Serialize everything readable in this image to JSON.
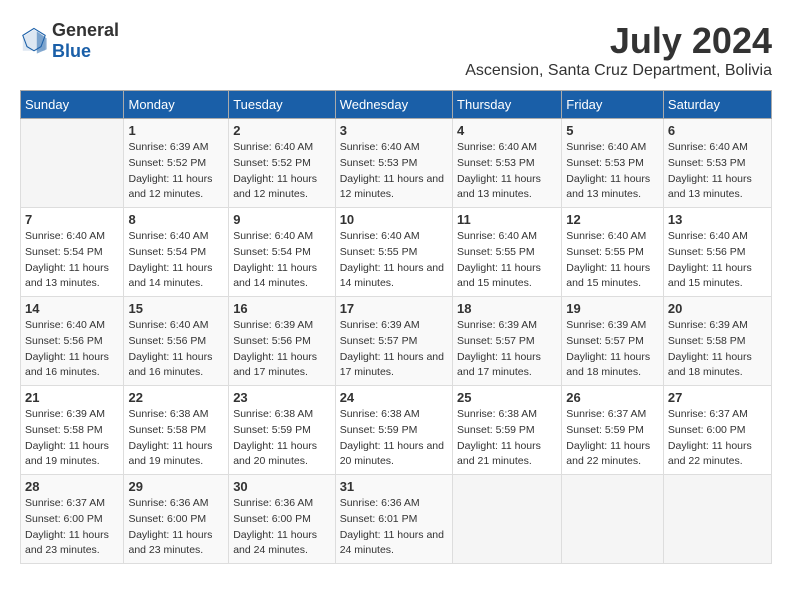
{
  "logo": {
    "text_general": "General",
    "text_blue": "Blue"
  },
  "title": {
    "month_year": "July 2024",
    "location": "Ascension, Santa Cruz Department, Bolivia"
  },
  "calendar": {
    "headers": [
      "Sunday",
      "Monday",
      "Tuesday",
      "Wednesday",
      "Thursday",
      "Friday",
      "Saturday"
    ],
    "weeks": [
      [
        {
          "day": "",
          "sunrise": "",
          "sunset": "",
          "daylight": ""
        },
        {
          "day": "1",
          "sunrise": "Sunrise: 6:39 AM",
          "sunset": "Sunset: 5:52 PM",
          "daylight": "Daylight: 11 hours and 12 minutes."
        },
        {
          "day": "2",
          "sunrise": "Sunrise: 6:40 AM",
          "sunset": "Sunset: 5:52 PM",
          "daylight": "Daylight: 11 hours and 12 minutes."
        },
        {
          "day": "3",
          "sunrise": "Sunrise: 6:40 AM",
          "sunset": "Sunset: 5:53 PM",
          "daylight": "Daylight: 11 hours and 12 minutes."
        },
        {
          "day": "4",
          "sunrise": "Sunrise: 6:40 AM",
          "sunset": "Sunset: 5:53 PM",
          "daylight": "Daylight: 11 hours and 13 minutes."
        },
        {
          "day": "5",
          "sunrise": "Sunrise: 6:40 AM",
          "sunset": "Sunset: 5:53 PM",
          "daylight": "Daylight: 11 hours and 13 minutes."
        },
        {
          "day": "6",
          "sunrise": "Sunrise: 6:40 AM",
          "sunset": "Sunset: 5:53 PM",
          "daylight": "Daylight: 11 hours and 13 minutes."
        }
      ],
      [
        {
          "day": "7",
          "sunrise": "Sunrise: 6:40 AM",
          "sunset": "Sunset: 5:54 PM",
          "daylight": "Daylight: 11 hours and 13 minutes."
        },
        {
          "day": "8",
          "sunrise": "Sunrise: 6:40 AM",
          "sunset": "Sunset: 5:54 PM",
          "daylight": "Daylight: 11 hours and 14 minutes."
        },
        {
          "day": "9",
          "sunrise": "Sunrise: 6:40 AM",
          "sunset": "Sunset: 5:54 PM",
          "daylight": "Daylight: 11 hours and 14 minutes."
        },
        {
          "day": "10",
          "sunrise": "Sunrise: 6:40 AM",
          "sunset": "Sunset: 5:55 PM",
          "daylight": "Daylight: 11 hours and 14 minutes."
        },
        {
          "day": "11",
          "sunrise": "Sunrise: 6:40 AM",
          "sunset": "Sunset: 5:55 PM",
          "daylight": "Daylight: 11 hours and 15 minutes."
        },
        {
          "day": "12",
          "sunrise": "Sunrise: 6:40 AM",
          "sunset": "Sunset: 5:55 PM",
          "daylight": "Daylight: 11 hours and 15 minutes."
        },
        {
          "day": "13",
          "sunrise": "Sunrise: 6:40 AM",
          "sunset": "Sunset: 5:56 PM",
          "daylight": "Daylight: 11 hours and 15 minutes."
        }
      ],
      [
        {
          "day": "14",
          "sunrise": "Sunrise: 6:40 AM",
          "sunset": "Sunset: 5:56 PM",
          "daylight": "Daylight: 11 hours and 16 minutes."
        },
        {
          "day": "15",
          "sunrise": "Sunrise: 6:40 AM",
          "sunset": "Sunset: 5:56 PM",
          "daylight": "Daylight: 11 hours and 16 minutes."
        },
        {
          "day": "16",
          "sunrise": "Sunrise: 6:39 AM",
          "sunset": "Sunset: 5:56 PM",
          "daylight": "Daylight: 11 hours and 17 minutes."
        },
        {
          "day": "17",
          "sunrise": "Sunrise: 6:39 AM",
          "sunset": "Sunset: 5:57 PM",
          "daylight": "Daylight: 11 hours and 17 minutes."
        },
        {
          "day": "18",
          "sunrise": "Sunrise: 6:39 AM",
          "sunset": "Sunset: 5:57 PM",
          "daylight": "Daylight: 11 hours and 17 minutes."
        },
        {
          "day": "19",
          "sunrise": "Sunrise: 6:39 AM",
          "sunset": "Sunset: 5:57 PM",
          "daylight": "Daylight: 11 hours and 18 minutes."
        },
        {
          "day": "20",
          "sunrise": "Sunrise: 6:39 AM",
          "sunset": "Sunset: 5:58 PM",
          "daylight": "Daylight: 11 hours and 18 minutes."
        }
      ],
      [
        {
          "day": "21",
          "sunrise": "Sunrise: 6:39 AM",
          "sunset": "Sunset: 5:58 PM",
          "daylight": "Daylight: 11 hours and 19 minutes."
        },
        {
          "day": "22",
          "sunrise": "Sunrise: 6:38 AM",
          "sunset": "Sunset: 5:58 PM",
          "daylight": "Daylight: 11 hours and 19 minutes."
        },
        {
          "day": "23",
          "sunrise": "Sunrise: 6:38 AM",
          "sunset": "Sunset: 5:59 PM",
          "daylight": "Daylight: 11 hours and 20 minutes."
        },
        {
          "day": "24",
          "sunrise": "Sunrise: 6:38 AM",
          "sunset": "Sunset: 5:59 PM",
          "daylight": "Daylight: 11 hours and 20 minutes."
        },
        {
          "day": "25",
          "sunrise": "Sunrise: 6:38 AM",
          "sunset": "Sunset: 5:59 PM",
          "daylight": "Daylight: 11 hours and 21 minutes."
        },
        {
          "day": "26",
          "sunrise": "Sunrise: 6:37 AM",
          "sunset": "Sunset: 5:59 PM",
          "daylight": "Daylight: 11 hours and 22 minutes."
        },
        {
          "day": "27",
          "sunrise": "Sunrise: 6:37 AM",
          "sunset": "Sunset: 6:00 PM",
          "daylight": "Daylight: 11 hours and 22 minutes."
        }
      ],
      [
        {
          "day": "28",
          "sunrise": "Sunrise: 6:37 AM",
          "sunset": "Sunset: 6:00 PM",
          "daylight": "Daylight: 11 hours and 23 minutes."
        },
        {
          "day": "29",
          "sunrise": "Sunrise: 6:36 AM",
          "sunset": "Sunset: 6:00 PM",
          "daylight": "Daylight: 11 hours and 23 minutes."
        },
        {
          "day": "30",
          "sunrise": "Sunrise: 6:36 AM",
          "sunset": "Sunset: 6:00 PM",
          "daylight": "Daylight: 11 hours and 24 minutes."
        },
        {
          "day": "31",
          "sunrise": "Sunrise: 6:36 AM",
          "sunset": "Sunset: 6:01 PM",
          "daylight": "Daylight: 11 hours and 24 minutes."
        },
        {
          "day": "",
          "sunrise": "",
          "sunset": "",
          "daylight": ""
        },
        {
          "day": "",
          "sunrise": "",
          "sunset": "",
          "daylight": ""
        },
        {
          "day": "",
          "sunrise": "",
          "sunset": "",
          "daylight": ""
        }
      ]
    ]
  }
}
